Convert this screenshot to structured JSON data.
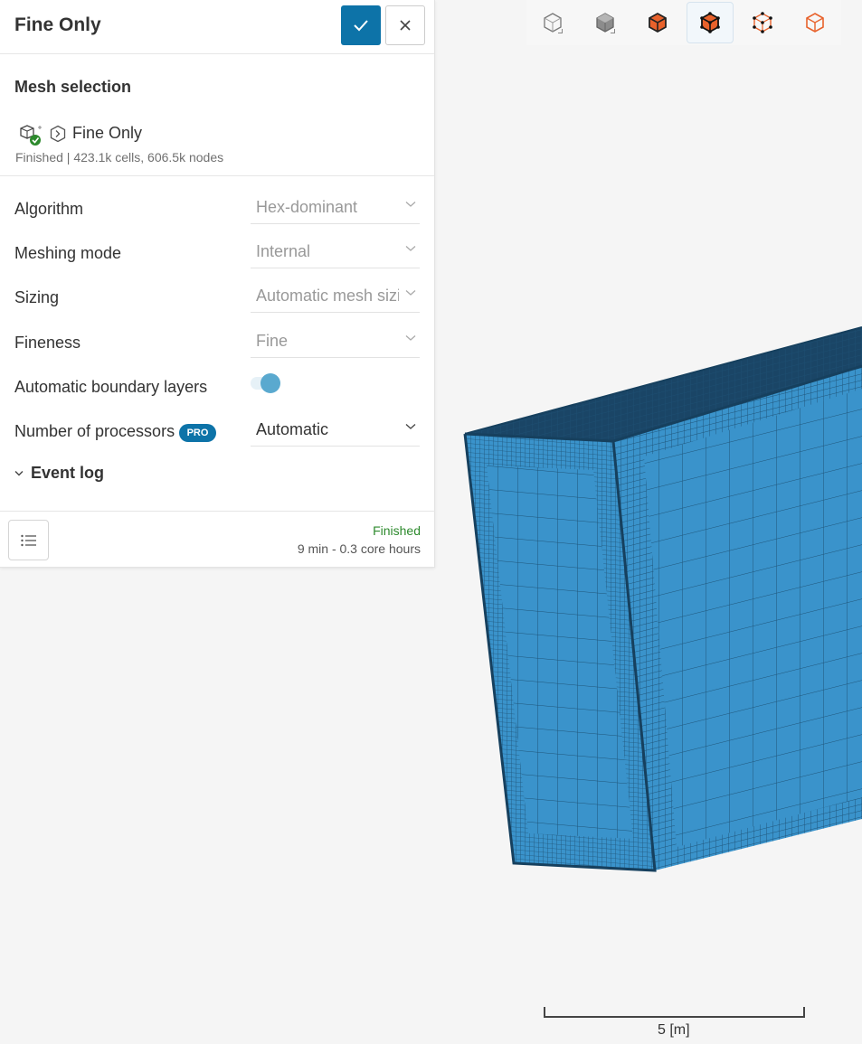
{
  "panel": {
    "title": "Fine Only",
    "mesh_selection": {
      "title": "Mesh selection",
      "mesh_name": "Fine Only",
      "mesh_status": "Finished | 423.1k cells, 606.5k nodes"
    },
    "settings": {
      "algorithm": {
        "label": "Algorithm",
        "value": "Hex-dominant"
      },
      "meshing_mode": {
        "label": "Meshing mode",
        "value": "Internal"
      },
      "sizing": {
        "label": "Sizing",
        "value": "Automatic mesh sizing"
      },
      "fineness": {
        "label": "Fineness",
        "value": "Fine"
      },
      "boundary_layers": {
        "label": "Automatic boundary layers",
        "enabled": true
      },
      "processors": {
        "label": "Number of processors",
        "badge": "PRO",
        "value": "Automatic"
      }
    },
    "event_log": {
      "label": "Event log"
    },
    "footer": {
      "status": "Finished",
      "time": "9 min - 0.3 core hours"
    }
  },
  "toolbar": {
    "icons": [
      "view-transparent-icon",
      "view-solid-icon",
      "view-solid-edges-icon",
      "view-solid-mesh-icon",
      "view-points-icon",
      "view-wireframe-icon"
    ],
    "active_index": 3
  },
  "viewport": {
    "scale_label": "5 [m]"
  },
  "colors": {
    "primary": "#0d73a8",
    "mesh_face": "#3a93cb",
    "mesh_dark": "#1d4f72",
    "success": "#2d8a2d",
    "accent_orange": "#e8622c"
  }
}
